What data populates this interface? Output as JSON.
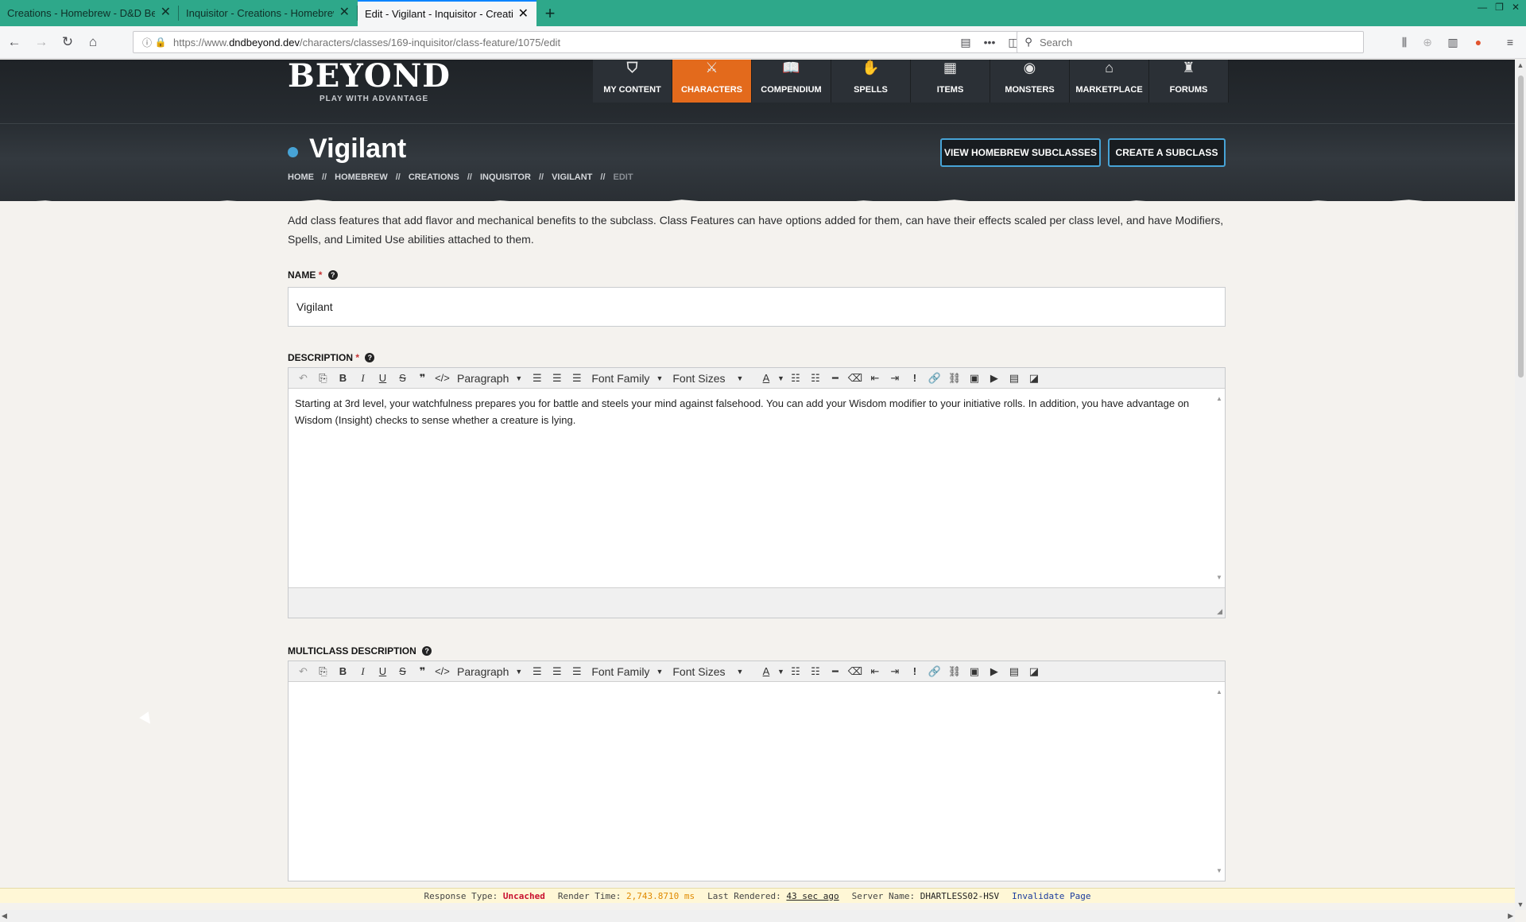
{
  "browser": {
    "tabs": [
      {
        "title": "Creations - Homebrew - D&D Beyo",
        "active": false
      },
      {
        "title": "Inquisitor - Creations - Homebrew",
        "active": false
      },
      {
        "title": "Edit - Vigilant - Inquisitor - Creation",
        "active": true
      }
    ],
    "url_prefix": "https://www.",
    "url_domain": "dndbeyond.dev",
    "url_path": "/characters/classes/169-inquisitor/class-feature/1075/edit",
    "search_placeholder": "Search"
  },
  "site": {
    "logo_text": "BEYOND",
    "logo_tagline": "PLAY WITH ADVANTAGE",
    "nav": [
      {
        "label": "MY CONTENT",
        "icon": "hood-icon",
        "active": false
      },
      {
        "label": "CHARACTERS",
        "icon": "characters-icon",
        "active": true
      },
      {
        "label": "COMPENDIUM",
        "icon": "book-icon",
        "active": false
      },
      {
        "label": "SPELLS",
        "icon": "hand-icon",
        "active": false
      },
      {
        "label": "ITEMS",
        "icon": "chest-icon",
        "active": false
      },
      {
        "label": "MONSTERS",
        "icon": "monster-icon",
        "active": false
      },
      {
        "label": "MARKETPLACE",
        "icon": "shop-icon",
        "active": false
      },
      {
        "label": "FORUMS",
        "icon": "forum-icon",
        "active": false
      }
    ]
  },
  "page": {
    "title": "Vigilant",
    "breadcrumb": [
      "HOME",
      "HOMEBREW",
      "CREATIONS",
      "INQUISITOR",
      "VIGILANT",
      "EDIT"
    ],
    "breadcrumb_sep": "//",
    "view_subclasses_label": "VIEW HOMEBREW SUBCLASSES",
    "create_subclass_label": "CREATE A SUBCLASS",
    "intro": "Add class features that add flavor and mechanical benefits to the subclass. Class Features can have options added for them, can have their effects scaled per class level, and have Modifiers, Spells, and Limited Use abilities attached to them."
  },
  "form": {
    "name_label": "NAME",
    "name_value": "Vigilant",
    "required_mark": "*",
    "description_label": "DESCRIPTION",
    "description_text": "Starting at 3rd level, your watchfulness prepares you for battle and steels your mind against falsehood. You can add your Wisdom modifier to your initiative rolls. In addition, you have advantage on Wisdom (Insight) checks to sense whether a creature is lying.",
    "multiclass_label": "MULTICLASS DESCRIPTION",
    "multiclass_text": "",
    "toolbar": {
      "paragraph": "Paragraph",
      "font_family": "Font Family",
      "font_sizes": "Font Sizes"
    }
  },
  "debug": {
    "response_type_label": "Response Type:",
    "response_type_value": "Uncached",
    "render_time_label": "Render Time:",
    "render_time_value": "2,743.8710 ms",
    "last_rendered_label": "Last Rendered:",
    "last_rendered_value": "43 sec ago",
    "server_name_label": "Server Name:",
    "server_name_value": "DHARTLESS02-HSV",
    "invalidate_label": "Invalidate Page"
  },
  "colors": {
    "tabbar": "#2ea88a",
    "nav_active": "#e36a1c",
    "button_border": "#47a3d6",
    "required": "#c53131"
  }
}
